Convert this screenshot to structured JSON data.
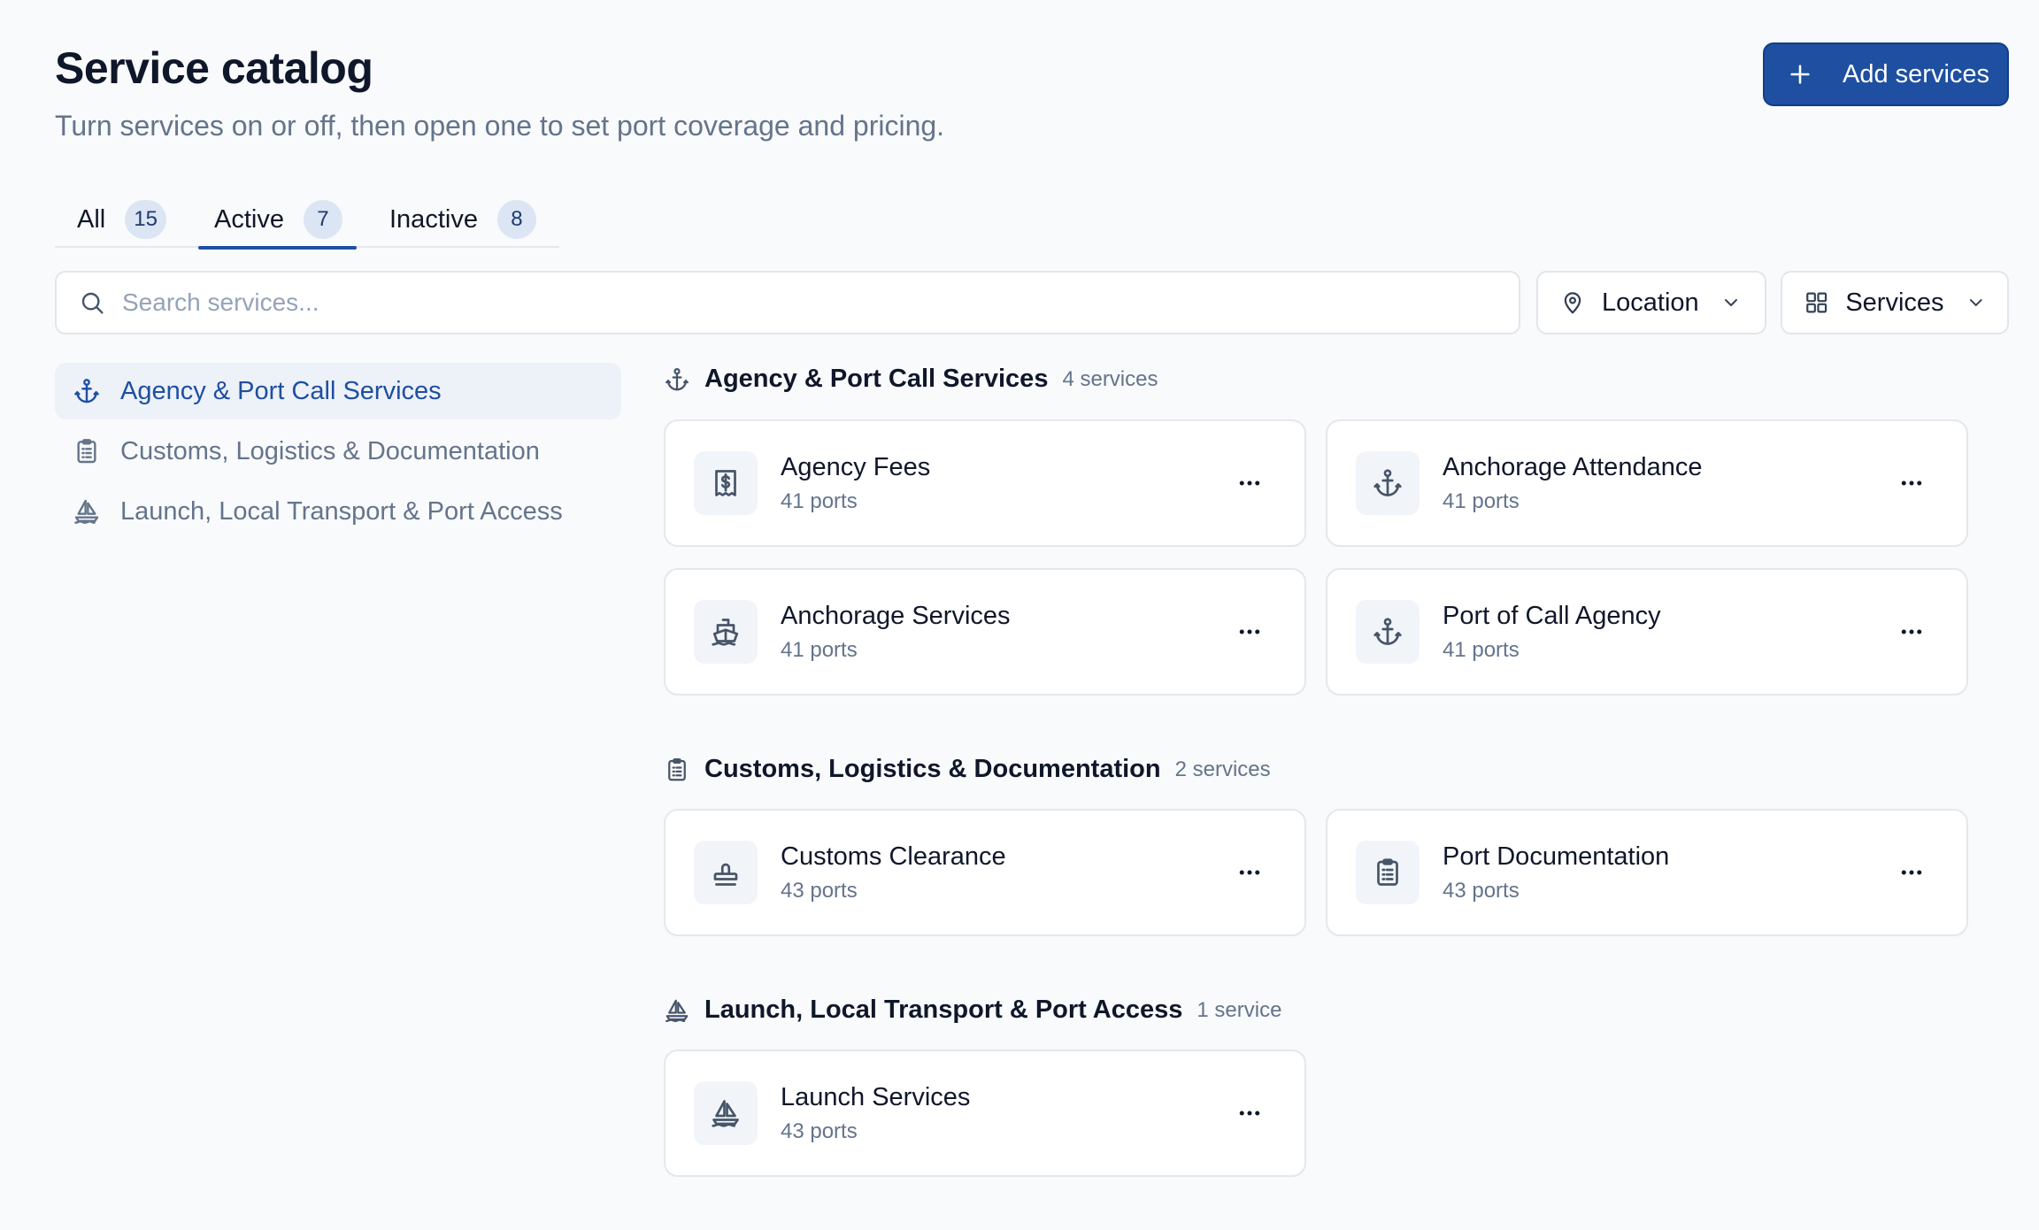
{
  "header": {
    "title": "Service catalog",
    "subtitle": "Turn services on or off, then open one to set port coverage and pricing.",
    "add_label": "Add services"
  },
  "tabs": [
    {
      "label": "All",
      "count": "15"
    },
    {
      "label": "Active",
      "count": "7"
    },
    {
      "label": "Inactive",
      "count": "8"
    }
  ],
  "search": {
    "placeholder": "Search services..."
  },
  "filters": {
    "location_label": "Location",
    "services_label": "Services"
  },
  "sidebar": {
    "items": [
      {
        "label": "Agency & Port Call Services",
        "icon": "anchor-icon"
      },
      {
        "label": "Customs, Logistics & Documentation",
        "icon": "clipboard-icon"
      },
      {
        "label": "Launch, Local Transport & Port Access",
        "icon": "sailboat-icon"
      }
    ]
  },
  "sections": [
    {
      "title": "Agency & Port Call Services",
      "count": "4 services",
      "cards": [
        {
          "name": "Agency Fees",
          "ports": "41 ports",
          "icon": "receipt-dollar-icon"
        },
        {
          "name": "Anchorage Attendance",
          "ports": "41 ports",
          "icon": "anchor-icon"
        },
        {
          "name": "Anchorage Services",
          "ports": "41 ports",
          "icon": "ship-icon"
        },
        {
          "name": "Port of Call Agency",
          "ports": "41 ports",
          "icon": "anchor-icon"
        }
      ]
    },
    {
      "title": "Customs, Logistics & Documentation",
      "count": "2 services",
      "cards": [
        {
          "name": "Customs Clearance",
          "ports": "43 ports",
          "icon": "stamp-icon"
        },
        {
          "name": "Port Documentation",
          "ports": "43 ports",
          "icon": "clipboard-icon"
        }
      ]
    },
    {
      "title": "Launch, Local Transport & Port Access",
      "count": "1 service",
      "cards": [
        {
          "name": "Launch Services",
          "ports": "43 ports",
          "icon": "sailboat-icon"
        }
      ]
    }
  ],
  "colors": {
    "accent": "#1e4fa1",
    "background": "#f9fafb",
    "muted_text": "#64748b"
  }
}
